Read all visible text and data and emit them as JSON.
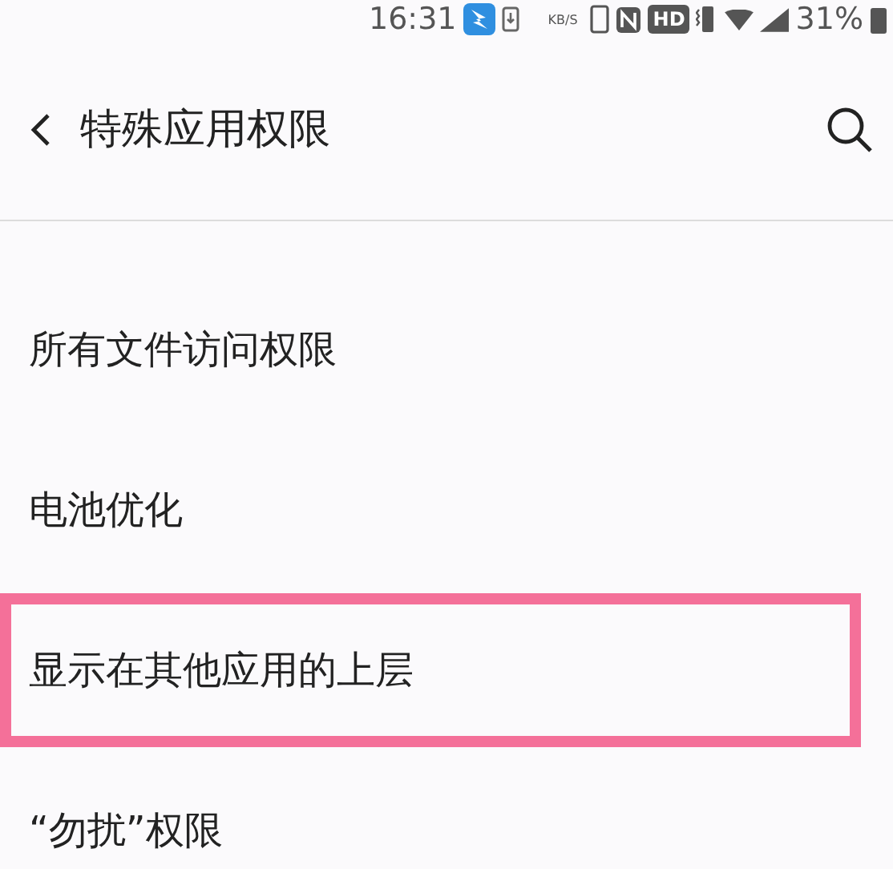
{
  "status_bar": {
    "time": "16:31",
    "speed_unit": "KB/S",
    "hd_badge": "HD",
    "battery": "31%"
  },
  "header": {
    "title": "特殊应用权限"
  },
  "items": [
    {
      "label": "所有文件访问权限",
      "highlighted": false
    },
    {
      "label": "电池优化",
      "highlighted": false
    },
    {
      "label": "显示在其他应用的上层",
      "highlighted": true
    },
    {
      "label": "“勿扰”权限",
      "highlighted": false
    }
  ]
}
